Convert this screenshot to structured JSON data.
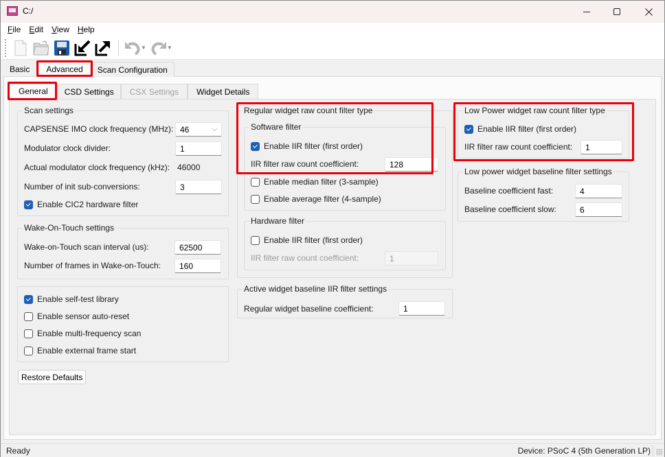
{
  "window": {
    "title": "C:/",
    "controls": {
      "minimize": "minimize",
      "maximize": "maximize",
      "close": "close"
    }
  },
  "menu": [
    {
      "label": "File",
      "mnemonic": "F",
      "rest": "ile"
    },
    {
      "label": "Edit",
      "mnemonic": "E",
      "rest": "dit"
    },
    {
      "label": "View",
      "mnemonic": "V",
      "rest": "iew"
    },
    {
      "label": "Help",
      "mnemonic": "H",
      "rest": "elp"
    }
  ],
  "toolbar": {
    "buttons": [
      {
        "name": "new-icon",
        "enabled": false
      },
      {
        "name": "open-icon",
        "enabled": false
      },
      {
        "name": "save-icon",
        "enabled": true
      },
      {
        "name": "import-icon",
        "enabled": true
      },
      {
        "name": "export-icon",
        "enabled": true
      },
      {
        "name": "undo-icon",
        "enabled": false
      },
      {
        "name": "redo-icon",
        "enabled": false
      }
    ]
  },
  "outer_tabs": [
    {
      "label": "Basic",
      "state": "inactive"
    },
    {
      "label": "Advanced",
      "state": "active"
    },
    {
      "label": "Scan Configuration",
      "state": "inactive"
    }
  ],
  "inner_tabs": [
    {
      "label": "General",
      "state": "active"
    },
    {
      "label": "CSD Settings",
      "state": "inactive"
    },
    {
      "label": "CSX Settings",
      "state": "disabled"
    },
    {
      "label": "Widget Details",
      "state": "inactive"
    }
  ],
  "scan_settings": {
    "title": "Scan settings",
    "imo_label": "CAPSENSE IMO clock frequency (MHz):",
    "imo_value": "46",
    "mod_div_label": "Modulator clock divider:",
    "mod_div_value": "1",
    "actual_mod_label": "Actual modulator clock frequency (kHz):",
    "actual_mod_value": "46000",
    "init_sub_label": "Number of init sub-conversions:",
    "init_sub_value": "3",
    "cic2_label": "Enable CIC2 hardware filter",
    "cic2_checked": true
  },
  "wot_settings": {
    "title": "Wake-On-Touch settings",
    "interval_label": "Wake-on-Touch scan interval (us):",
    "interval_value": "62500",
    "frames_label": "Number of frames in Wake-on-Touch:",
    "frames_value": "160"
  },
  "misc_options": [
    {
      "label": "Enable self-test library",
      "checked": true
    },
    {
      "label": "Enable sensor auto-reset",
      "checked": false
    },
    {
      "label": "Enable multi-frequency scan",
      "checked": false
    },
    {
      "label": "Enable external frame start",
      "checked": false
    }
  ],
  "restore_defaults": "Restore Defaults",
  "regular_filter": {
    "title": "Regular widget raw count filter type",
    "software": {
      "title": "Software filter",
      "iir_label": "Enable IIR filter (first order)",
      "iir_checked": true,
      "coef_label": "IIR filter raw count coefficient:",
      "coef_value": "128",
      "median_label": "Enable median filter (3-sample)",
      "median_checked": false,
      "average_label": "Enable average filter (4-sample)",
      "average_checked": false
    },
    "hardware": {
      "title": "Hardware filter",
      "iir_label": "Enable IIR filter (first order)",
      "iir_checked": false,
      "coef_label": "IIR filter raw count coefficient:",
      "coef_value": "1"
    }
  },
  "active_baseline": {
    "title": "Active widget baseline IIR filter settings",
    "coef_label": "Regular widget baseline coefficient:",
    "coef_value": "1"
  },
  "lp_filter": {
    "title": "Low Power widget raw count filter type",
    "iir_label": "Enable IIR filter (first order)",
    "iir_checked": true,
    "coef_label": "IIR filter raw count coefficient:",
    "coef_value": "1"
  },
  "lp_baseline": {
    "title": "Low power widget baseline filter settings",
    "fast_label": "Baseline coefficient fast:",
    "fast_value": "4",
    "slow_label": "Baseline coefficient slow:",
    "slow_value": "6"
  },
  "status": {
    "left": "Ready",
    "right": "Device: PSoC 4 (5th Generation LP)"
  },
  "colors": {
    "highlight": "#e8000b",
    "checkbox_checked": "#1f5fb5"
  }
}
